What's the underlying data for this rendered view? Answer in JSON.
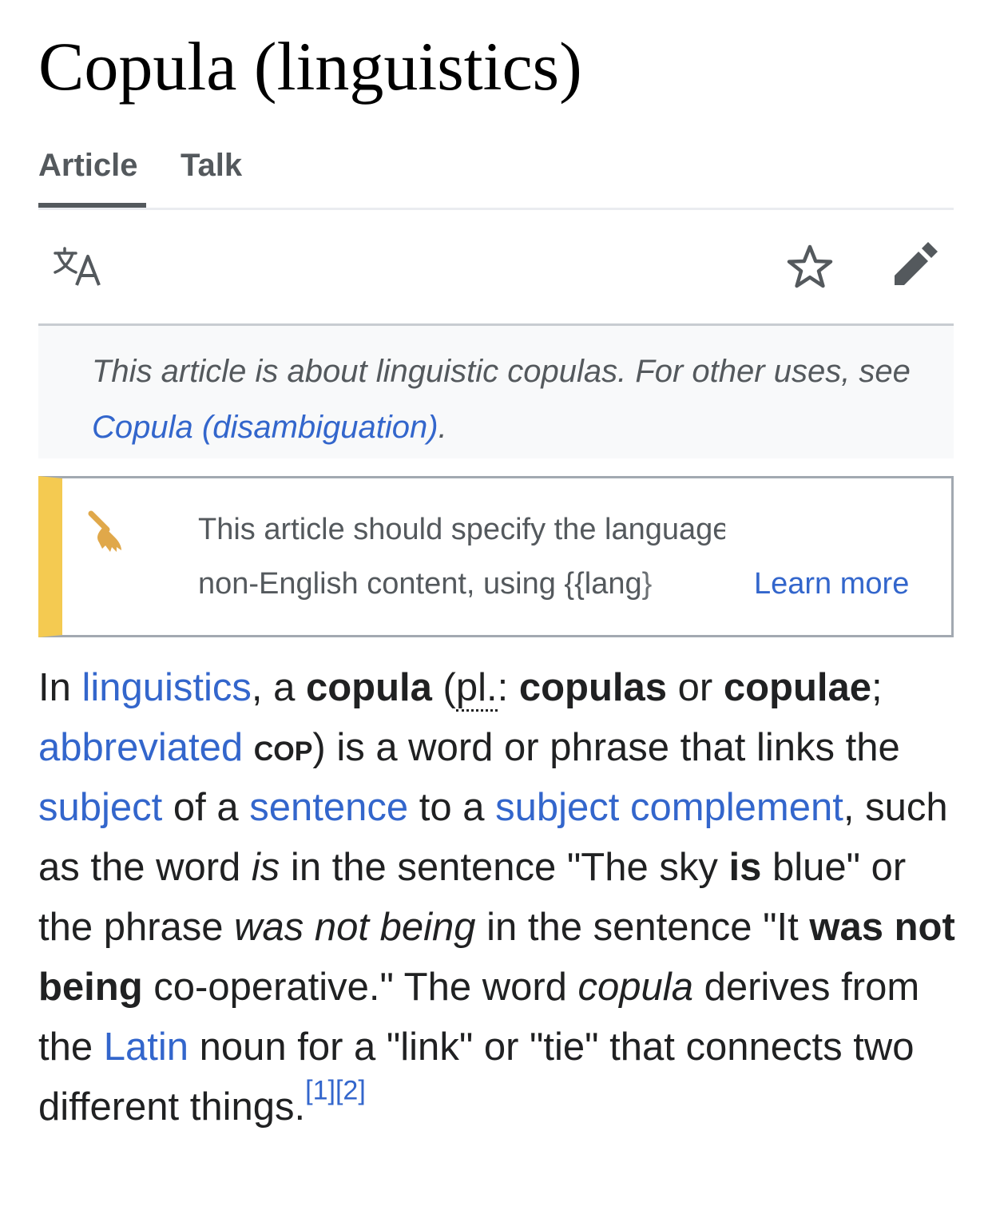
{
  "page": {
    "title": "Copula (linguistics)"
  },
  "tabs": [
    {
      "label": "Article",
      "active": true
    },
    {
      "label": "Talk",
      "active": false
    }
  ],
  "toolbar": {
    "language_icon": "language-icon",
    "watch_icon": "star-icon",
    "edit_icon": "pencil-icon"
  },
  "hatnote": {
    "text_before": "This article is about linguistic copulas. For other uses, see ",
    "link": "Copula (disambiguation)",
    "text_after": "."
  },
  "ambox": {
    "icon": "broom-icon",
    "line1": "This article should specify the language of its",
    "line2": "non-English content, using {{lang}",
    "learn_more": "Learn more",
    "accent_color": "#f4ca51"
  },
  "lead": {
    "t1": "In ",
    "l_linguistics": "linguistics",
    "t2": ", a ",
    "b_copula": "copula",
    "t3": " (",
    "abbr_pl": "pl.",
    "t4": ": ",
    "b_copulas": "copulas",
    "t5": " or ",
    "b_copulae": "copulae",
    "t6": "; ",
    "l_abbreviated": "abbreviated",
    "t7": " ",
    "sc_cop": "cop",
    "t8": ") is a word or phrase that links the ",
    "l_subject": "subject",
    "t9": " of a ",
    "l_sentence": "sentence",
    "t10": " to a ",
    "l_subject_complement": "subject complement",
    "t11": ", such as the word ",
    "i_is": "is",
    "t12": " in the sentence \"The sky ",
    "b_is": "is",
    "t13": " blue\" or the phrase ",
    "i_was_not_being": "was not being",
    "t14": " in the sentence \"It ",
    "b_was_not_being": "was not being",
    "t15": " co-operative.\" The word ",
    "i_copula": "copula",
    "t16": " derives from the ",
    "l_latin": "Latin",
    "t17": " noun for a \"link\" or \"tie\" that connects two different things.",
    "ref1": "[1]",
    "ref2": "[2]"
  },
  "colors": {
    "link": "#3366cc",
    "text": "#202122",
    "muted": "#54595d"
  }
}
